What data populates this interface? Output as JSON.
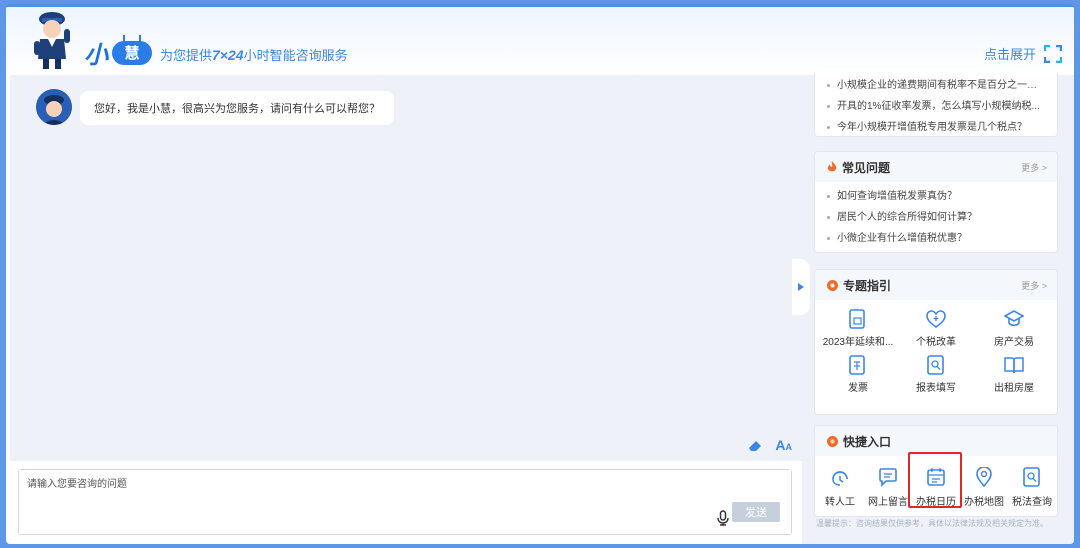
{
  "header": {
    "brand_xiao": "小",
    "brand_hui": "慧",
    "slogan_pre": "为您提供",
    "slogan_bold": "7×24",
    "slogan_post": "小时智能咨询服务",
    "expand_label": "点击展开"
  },
  "chat": {
    "greeting": "您好，我是小慧，很高兴为您服务，请问有什么可以帮您？",
    "font_tool_big": "A",
    "font_tool_small": "A"
  },
  "input": {
    "placeholder": "请输入您要咨询的问题",
    "send_label": "发送"
  },
  "top_list": {
    "items": [
      "小规模企业的递费期间有税率不是百分之一吗...",
      "开具的1%征收率发票，怎么填写小规模纳税...",
      "今年小规模开增值税专用发票是几个税点？"
    ]
  },
  "faq": {
    "title": "常见问题",
    "more": "更多 >",
    "items": [
      "如何查询增值税发票真伪？",
      "居民个人的综合所得如何计算？",
      "小微企业有什么增值税优惠？"
    ]
  },
  "topics": {
    "title": "专题指引",
    "more": "更多 >",
    "items": [
      {
        "label": "2023年延续和...",
        "icon": "document-icon"
      },
      {
        "label": "个税改革",
        "icon": "heart-plus-icon"
      },
      {
        "label": "房产交易",
        "icon": "graduation-cap-icon"
      },
      {
        "label": "发票",
        "icon": "invoice-icon"
      },
      {
        "label": "报表填写",
        "icon": "search-doc-icon"
      },
      {
        "label": "出租房屋",
        "icon": "book-icon"
      }
    ]
  },
  "quick": {
    "title": "快捷入口",
    "items": [
      {
        "label": "转人工",
        "icon": "headset-icon"
      },
      {
        "label": "网上留言",
        "icon": "message-icon"
      },
      {
        "label": "办税日历",
        "icon": "calendar-icon"
      },
      {
        "label": "办税地图",
        "icon": "map-pin-icon"
      },
      {
        "label": "税法查询",
        "icon": "search-doc-icon"
      }
    ]
  },
  "tip": "温馨提示：咨询结果仅供参考，具体以法律法规及相关规定为准。",
  "colors": {
    "accent": "#3d86e8",
    "highlight": "#e3262d",
    "panel_bg": "#eef2f8"
  }
}
